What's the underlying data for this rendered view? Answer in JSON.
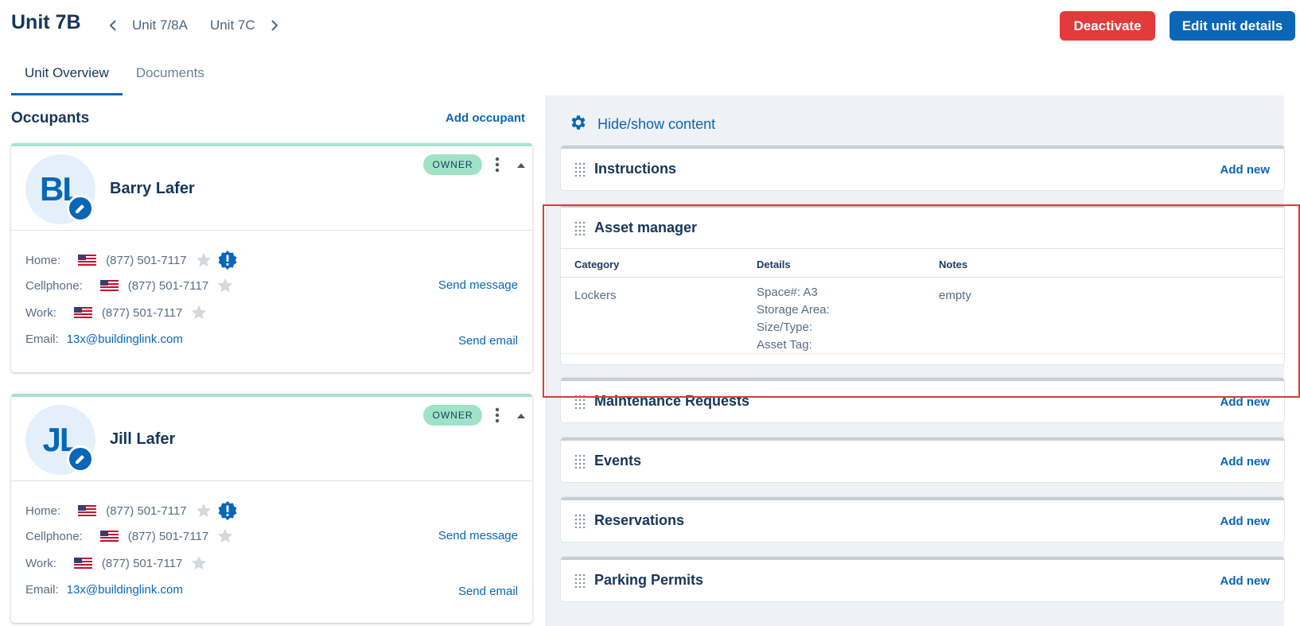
{
  "header": {
    "unit_title": "Unit 7B",
    "prev_unit": "Unit 7/8A",
    "next_unit": "Unit 7C",
    "deactivate_label": "Deactivate",
    "edit_label": "Edit unit details",
    "colors": {
      "danger": "#e33b3b",
      "primary": "#0a66b7"
    }
  },
  "tabs": [
    {
      "label": "Unit Overview",
      "active": true
    },
    {
      "label": "Documents",
      "active": false
    }
  ],
  "occupants": {
    "title": "Occupants",
    "add_label": "Add occupant",
    "list": [
      {
        "initials": "BL",
        "name": "Barry Lafer",
        "badge": "OWNER",
        "home_label": "Home:",
        "home_phone": "(877) 501-7117",
        "cell_label": "Cellphone:",
        "cell_phone": "(877) 501-7117",
        "work_label": "Work:",
        "work_phone": "(877) 501-7117",
        "email_label": "Email:",
        "email": "13x@buildinglink.com",
        "send_message": "Send message",
        "send_email": "Send email"
      },
      {
        "initials": "JL",
        "name": "Jill Lafer",
        "badge": "OWNER",
        "home_label": "Home:",
        "home_phone": "(877) 501-7117",
        "cell_label": "Cellphone:",
        "cell_phone": "(877) 501-7117",
        "work_label": "Work:",
        "work_phone": "(877) 501-7117",
        "email_label": "Email:",
        "email": "13x@buildinglink.com",
        "send_message": "Send message",
        "send_email": "Send email"
      }
    ]
  },
  "content": {
    "hide_show_label": "Hide/show content",
    "add_new_label": "Add new",
    "instructions_title": "Instructions",
    "asset_manager": {
      "title": "Asset manager",
      "columns": [
        "Category",
        "Details",
        "Notes"
      ],
      "rows": [
        {
          "category": "Lockers",
          "details": [
            "Space#: A3",
            "Storage Area:",
            "Size/Type:",
            "Asset Tag:"
          ],
          "notes": "empty"
        }
      ]
    },
    "maintenance_title": "Maintenance Requests",
    "events_title": "Events",
    "reservations_title": "Reservations",
    "parking_title": "Parking Permits"
  },
  "icons": {
    "prev": "chevron-left-icon",
    "next": "chevron-right-icon",
    "gear": "gear-icon",
    "grip": "drag-handle-icon",
    "star": "star-icon",
    "alert": "alert-badge-icon",
    "edit": "pencil-icon",
    "flag": "us-flag-icon"
  }
}
